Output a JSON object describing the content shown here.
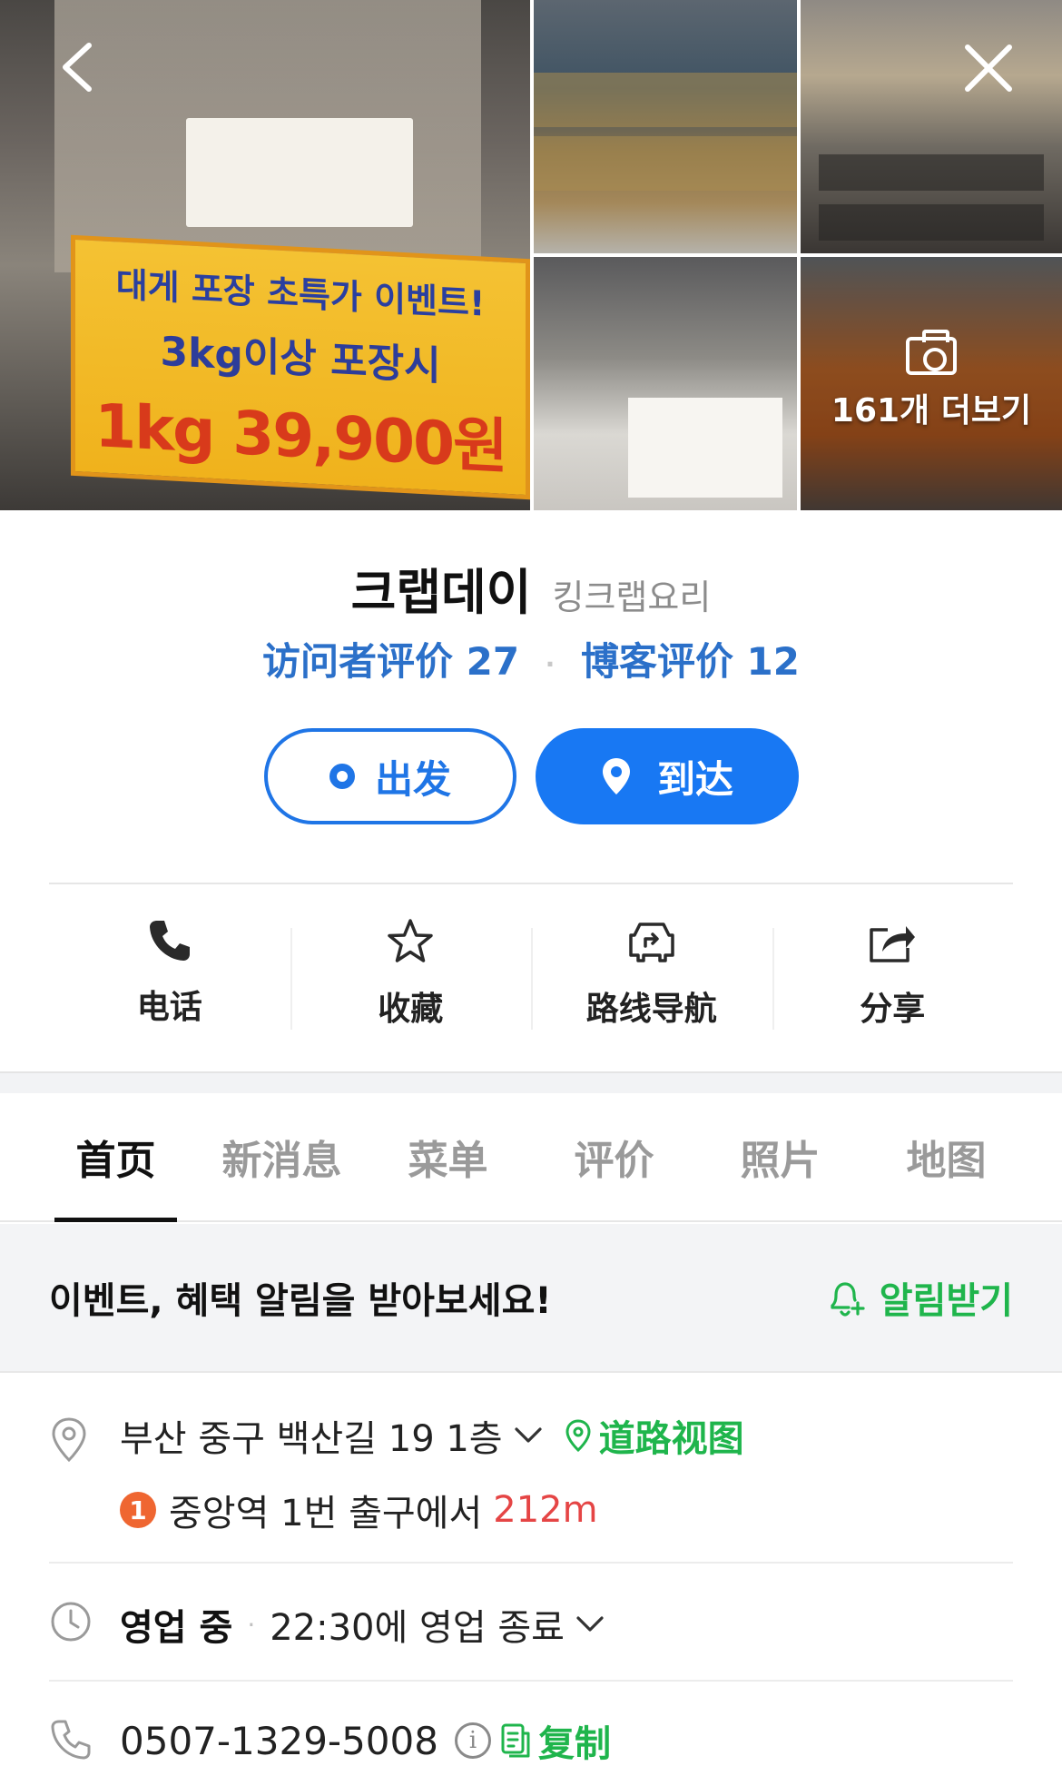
{
  "gallery": {
    "banner_lines": [
      "대게 포장 초특가 이벤트!",
      "3kg이상 포장시",
      "1kg 39,900원"
    ],
    "more_photos_label": "161개 더보기",
    "icons": {
      "back": "chevron-left-icon",
      "close": "close-icon",
      "camera": "camera-icon"
    }
  },
  "place": {
    "name": "크랩데이",
    "category": "킹크랩요리",
    "visitor_reviews": "访问者评价 27",
    "blog_reviews": "博客评价 12",
    "separator": "·"
  },
  "route": {
    "depart_label": "出发",
    "arrive_label": "到达"
  },
  "actions": [
    {
      "label": "电话",
      "icon": "phone-icon"
    },
    {
      "label": "收藏",
      "icon": "star-icon"
    },
    {
      "label": "路线导航",
      "icon": "navigation-icon"
    },
    {
      "label": "分享",
      "icon": "share-icon"
    }
  ],
  "tabs": [
    "首页",
    "新消息",
    "菜单",
    "评价",
    "照片",
    "地图"
  ],
  "active_tab": "首页",
  "notice": {
    "text": "이벤트, 혜택 알림을 받아보세요!",
    "button_label": "알림받기"
  },
  "address": {
    "text": "부산 중구 백산길 19 1층",
    "road_view_label": "道路视图",
    "subway_line": "1",
    "subway_text": "중앙역 1번 출구에서",
    "distance": "212m"
  },
  "hours": {
    "status": "영업 중",
    "separator": "·",
    "close_text": "22:30에 영업 종료"
  },
  "phone": {
    "number": "0507-1329-5008",
    "info_glyph": "i",
    "copy_label": "复制"
  },
  "colors": {
    "accent_blue": "#1878f3",
    "review_blue": "#2b70c9",
    "green": "#1fb54c",
    "distance_red": "#e54545",
    "line1_orange": "#ef6631"
  }
}
